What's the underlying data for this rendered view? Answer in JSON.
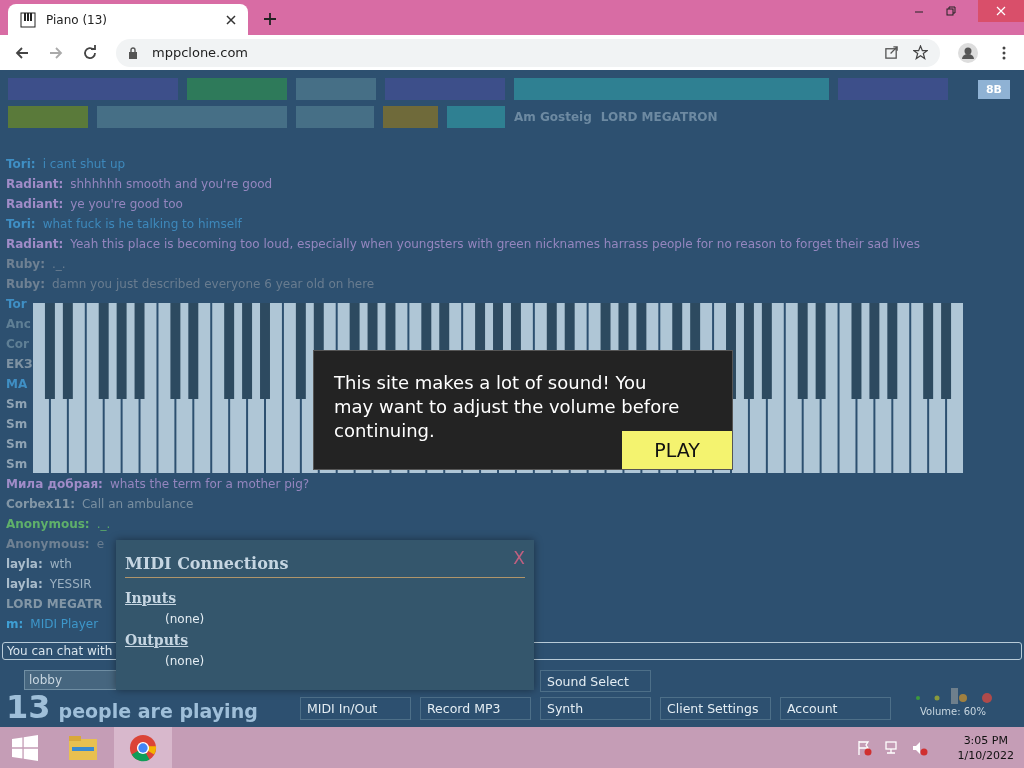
{
  "browser": {
    "tab_title": "Piano (13)",
    "url": "mppclone.com"
  },
  "participants": {
    "tags": [
      {
        "color": "#3d4f8a"
      },
      {
        "color": "#2e7a5a"
      },
      {
        "color": "#466f86"
      },
      {
        "color": "#3d4f8a"
      },
      {
        "color": "#2f8092"
      },
      {
        "color": "#3d4f8a"
      },
      {
        "color": "#5a7a3a"
      },
      {
        "color": "#466f86"
      },
      {
        "color": "#466f86"
      },
      {
        "color": "#6f6a3a"
      },
      {
        "color": "#2f8092"
      }
    ],
    "names": [
      "Am Gosteig",
      "LORD MEGATRON"
    ],
    "menu_button": "8B"
  },
  "chat": {
    "messages": [
      {
        "name": "Tori:",
        "text": "i cant shut up",
        "color": "#3f8fc4"
      },
      {
        "name": "Radiant:",
        "text": "shhhhhh smooth and you're good",
        "color": "#a08cc8"
      },
      {
        "name": "Radiant:",
        "text": "ye you're good too",
        "color": "#a08cc8"
      },
      {
        "name": "Tori:",
        "text": "what fuck is he talking to himself",
        "color": "#3f8fc4"
      },
      {
        "name": "Radiant:",
        "text": "Yeah this place is becoming too loud, especially when youngsters with green nicknames harrass people for no reason to forget their sad lives",
        "color": "#a08cc8"
      },
      {
        "name": "Ruby:",
        "text": "._.",
        "color": "#6f8193"
      },
      {
        "name": "Ruby:",
        "text": "damn you just described everyone 6 year old on here",
        "color": "#6f8193"
      },
      {
        "name": "Tor",
        "color": "#3f8fc4"
      },
      {
        "name": "Anc",
        "color": "#5f7f95"
      },
      {
        "name": "Cor",
        "color": "#5f7f95"
      },
      {
        "name": "ЕКЗ",
        "color": "#7f93a3"
      },
      {
        "name": "MA",
        "color": "#3f8fc4"
      },
      {
        "name": "Sm",
        "color": "#8fa3b3"
      },
      {
        "name": "Sm",
        "color": "#8fa3b3"
      },
      {
        "name": "Sm",
        "color": "#8fa3b3"
      },
      {
        "name": "Sm",
        "color": "#8fa3b3"
      },
      {
        "name": "Мила добрая:",
        "text": "whats the term for a mother pig?",
        "color": "#a08cc8"
      },
      {
        "name": "Corbex11:",
        "text": "Call an ambulance",
        "color": "#8296a6"
      },
      {
        "name": "Anonymous:",
        "text": "._.",
        "color": "#5fb06a"
      },
      {
        "name": "Anonymous:",
        "text": "e",
        "color": "#6f8193"
      },
      {
        "name": "layla:",
        "text": "wth",
        "color": "#a9bccb"
      },
      {
        "name": "layla:",
        "text": "YESSIR",
        "color": "#a9bccb"
      },
      {
        "name": "LORD MEGATR",
        "color": "#8296a6"
      },
      {
        "name": "m:",
        "text": "MIDI Player",
        "color": "#3f9fd4"
      }
    ],
    "input_placeholder": "You can chat with"
  },
  "notification": {
    "message": "This site makes a lot of sound! You may want to adjust the volume before continuing.",
    "button": "PLAY"
  },
  "midi_panel": {
    "title": "MIDI Connections",
    "close": "X",
    "sections": [
      {
        "heading": "Inputs",
        "value": "(none)"
      },
      {
        "heading": "Outputs",
        "value": "(none)"
      }
    ]
  },
  "bottom": {
    "room": "lobby",
    "count": "13",
    "count_label": "people are playing",
    "buttons": [
      {
        "label": "Sound Select"
      },
      {
        "label": "MIDI In/Out"
      },
      {
        "label": "Record MP3"
      },
      {
        "label": "Synth"
      },
      {
        "label": "Client Settings"
      },
      {
        "label": "Account"
      }
    ],
    "volume": "Volume: 60%"
  },
  "taskbar": {
    "time": "3:05 PM",
    "date": "1/10/2022"
  }
}
